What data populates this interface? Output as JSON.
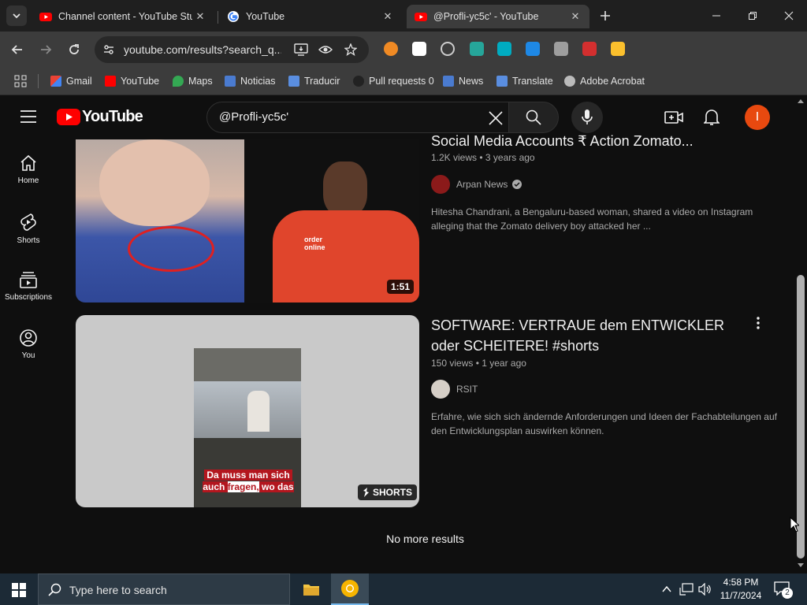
{
  "browser": {
    "tabs": [
      {
        "title": "Channel content - YouTube Stu",
        "active": false
      },
      {
        "title": "YouTube",
        "active": false
      },
      {
        "title": "@Profli-yc5c' - YouTube",
        "active": true
      }
    ],
    "url": "youtube.com/results?search_q...",
    "bookmarks": [
      "Gmail",
      "YouTube",
      "Maps",
      "Noticias",
      "Traducir",
      "Pull requests 0",
      "News",
      "Translate",
      "Adobe Acrobat"
    ]
  },
  "youtube": {
    "logo_text": "YouTube",
    "search_query": "@Profli-yc5c'",
    "avatar_letter": "I",
    "sidebar": [
      {
        "label": "Home",
        "icon": "home-icon"
      },
      {
        "label": "Shorts",
        "icon": "shorts-icon"
      },
      {
        "label": "Subscriptions",
        "icon": "subscriptions-icon"
      },
      {
        "label": "You",
        "icon": "you-icon"
      }
    ]
  },
  "results": [
    {
      "title": "Social Media Accounts ₹ Action Zomato...",
      "meta": "1.2K views • 3 years ago",
      "channel": "Arpan News",
      "verified": true,
      "description": "Hitesha Chandrani, a Bengaluru-based woman, shared a video on Instagram alleging that the Zomato delivery boy attacked her ...",
      "duration": "1:51",
      "thumb_text": "order online"
    },
    {
      "title": "SOFTWARE: VERTRAUE dem ENTWICKLER oder SCHEITERE! #shorts",
      "meta": "150 views • 1 year ago",
      "channel": "RSIT",
      "verified": false,
      "description": "Erfahre, wie sich sich ändernde Anforderungen und Ideen der Fachabteilungen auf den Entwicklungsplan auswirken können.",
      "badge": "SHORTS",
      "caption_line1": "Da muss man sich",
      "caption_line2_a": "auch ",
      "caption_line2_b": "fragen,",
      "caption_line2_c": " wo das"
    }
  ],
  "end_text": "No more results",
  "taskbar": {
    "search_placeholder": "Type here to search",
    "time": "4:58 PM",
    "date": "11/7/2024",
    "notification_count": "2"
  },
  "colors": {
    "yt_red": "#ff0000",
    "avatar": "#e8490f",
    "chrome_tab_bg": "#1f1f1f",
    "chrome_toolbar": "#3c3c3c",
    "taskbar": "#1c2a36"
  }
}
